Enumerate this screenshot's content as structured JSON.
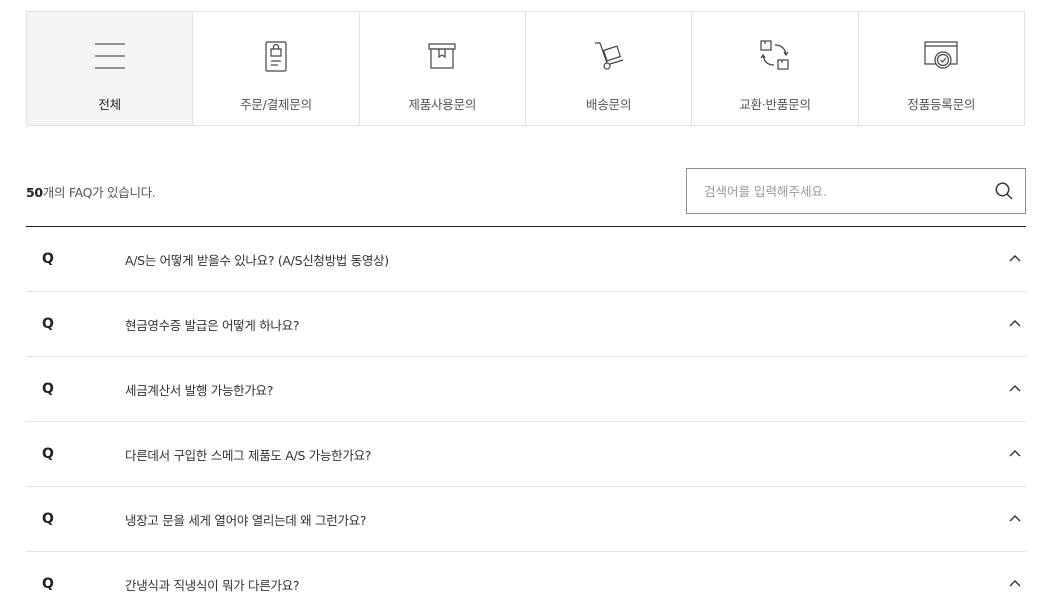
{
  "tabs": [
    {
      "label": "전체",
      "icon": "menu-lines-icon",
      "active": true
    },
    {
      "label": "주문/결제문의",
      "icon": "order-receipt-icon",
      "active": false
    },
    {
      "label": "제품사용문의",
      "icon": "product-box-icon",
      "active": false
    },
    {
      "label": "배송문의",
      "icon": "delivery-cart-icon",
      "active": false
    },
    {
      "label": "교환·반품문의",
      "icon": "exchange-return-icon",
      "active": false
    },
    {
      "label": "정품등록문의",
      "icon": "certificate-icon",
      "active": false
    }
  ],
  "summary": {
    "count": "50",
    "suffix": "개의 FAQ가 있습니다."
  },
  "search": {
    "placeholder": "검색어를 입력해주세요.",
    "value": "",
    "icon": "search-icon"
  },
  "faq": {
    "q_marker": "Q",
    "items": [
      {
        "question": "A/S는 어떻게 받을수 있나요? (A/S신청방법 동영상)"
      },
      {
        "question": "현금영수증 발급은 어떻게 하나요?"
      },
      {
        "question": "세금계산서 발행 가능한가요?"
      },
      {
        "question": "다른데서 구입한 스메그 제품도 A/S 가능한가요?"
      },
      {
        "question": "냉장고 문을 세게 열어야 열리는데 왜 그런가요?"
      },
      {
        "question": "간냉식과 직냉식이 뭐가 다른가요?"
      }
    ],
    "toggle_icon": "chevron-up-icon"
  },
  "colors": {
    "active_tab_bg": "#f5f5f5",
    "border": "#e1e1e1",
    "list_top_border": "#222222",
    "search_border": "#8e8e8e"
  }
}
